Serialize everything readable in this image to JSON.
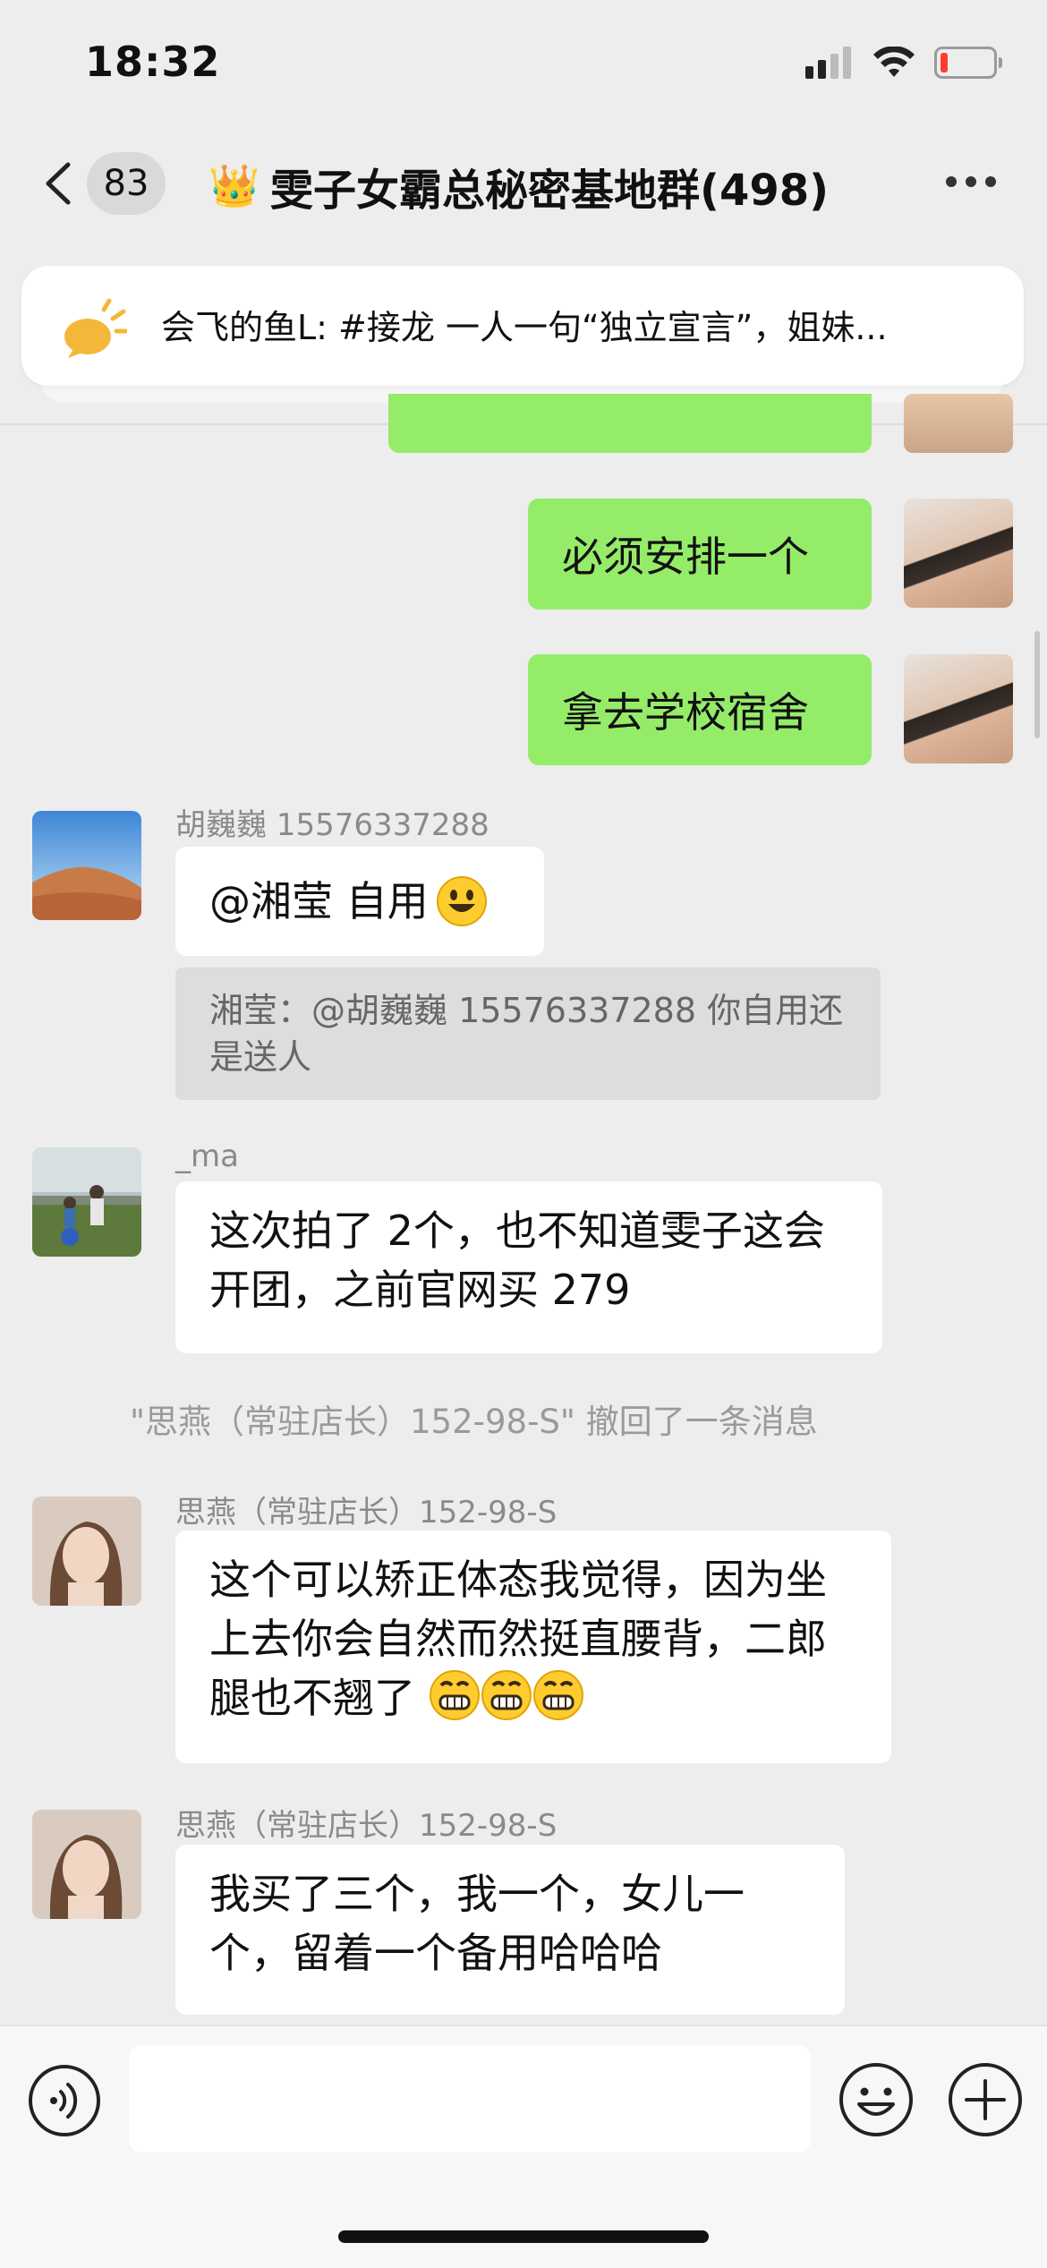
{
  "status_bar": {
    "time": "18:32"
  },
  "header": {
    "unread_count": "83",
    "crown_emoji": "👑",
    "title": "雯子女霸总秘密基地群(498)"
  },
  "pinned": {
    "text": "会飞的鱼L: #接龙 一人一句“独立宣言”，姐妹..."
  },
  "messages": {
    "m1": {
      "text": "必须安排一个"
    },
    "m2": {
      "text": "拿去学校宿舍"
    },
    "m3": {
      "sender": "胡巍巍 15576337288",
      "text": "@湘莹 自用",
      "quote": "湘莹：@胡巍巍 15576337288 你自用还是送人"
    },
    "m4": {
      "sender": "_ma",
      "text": "这次拍了 2个，也不知道雯子这会开团，之前官网买 279"
    },
    "system": "\"思燕（常驻店长）152-98-S\" 撤回了一条消息",
    "m5": {
      "sender": "思燕（常驻店长）152-98-S",
      "text": "这个可以矫正体态我觉得，因为坐上去你会自然而然挺直腰背，二郎腿也不翘了"
    },
    "m6": {
      "sender": "思燕（常驻店长）152-98-S",
      "text": "我买了三个，我一个，女儿一个，留着一个备用哈哈哈"
    }
  },
  "input": {
    "placeholder": ""
  },
  "colors": {
    "self_bubble": "#95ec69",
    "background": "#ededed",
    "battery_low": "#ff3b30"
  },
  "icons": [
    "back-icon",
    "more-icon",
    "bulb-icon",
    "voice-icon",
    "emoji-icon",
    "plus-icon",
    "signal-icon",
    "wifi-icon",
    "battery-icon"
  ]
}
